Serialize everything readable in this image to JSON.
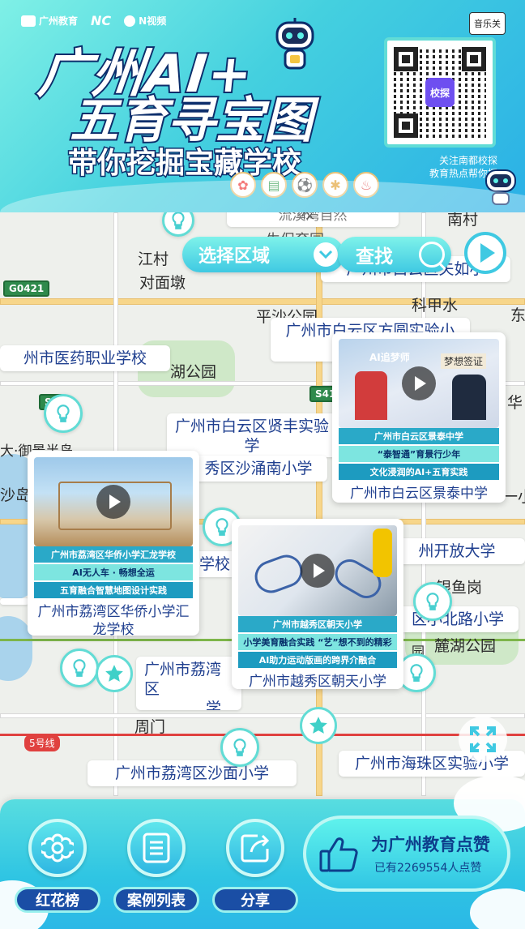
{
  "header": {
    "logos": [
      "广州教育",
      "NC",
      "N视频"
    ],
    "title_line1": "广州AI+",
    "title_line2": "五育寻宝图",
    "title_line3": "带你挖掘宝藏学校",
    "music_button": "音乐关",
    "qr_center_label": "校探",
    "follow_line1": "关注南都校探",
    "follow_line2": "教育热点帮你探",
    "edu_icons": [
      "ribbon-icon",
      "book-icon",
      "football-icon",
      "palette-icon",
      "chef-hat-icon"
    ]
  },
  "controls": {
    "area_button": "选择区域",
    "search_button": "查找"
  },
  "map": {
    "places": [
      "南村",
      "江村",
      "对面墩",
      "平沙公园",
      "科甲水",
      "麓湖公园",
      "银鱼岗",
      "周门",
      "湖公园",
      "沙岛",
      "大·御景半岛",
      "华",
      "东",
      "园",
      "一小",
      "流溪湾自然",
      "生保育园",
      "校"
    ],
    "road_shields": [
      "G0421",
      "S41",
      "S1"
    ],
    "metro_badge": "5号线",
    "labels": [
      "广州市白云区夫如小",
      "广州市白云区方圆实验小",
      "州市医药职业学校",
      "广州市白云区贤丰实验学",
      "秀区沙涌南小学",
      "学校",
      "州开放大学",
      "区小北路小学",
      "广州市荔湾区沙面小学",
      "广州市海珠区实验小学",
      "广州市荔湾区华侨小学汇龙学校",
      "广州市荔湾区",
      "学教育集团",
      "广州市越秀区朝天小学"
    ],
    "cards": [
      {
        "name": "广州市白云区景泰中学",
        "poster_title": "广州市白云区景泰中学",
        "poster_line1": "“泰智通”育景行少年",
        "poster_line2": "文化浸润的AI+五育实践",
        "poster_overlay1": "AI追梦师",
        "poster_overlay2": "梦想签证"
      },
      {
        "name": "广州市荔湾区华侨小学汇龙学校",
        "poster_title": "广州市荔湾区华侨小学汇龙学校",
        "poster_line1": "AI无人车 · 畅想全运",
        "poster_line2": "五育融合智慧地图设计实践"
      },
      {
        "name": "广州市越秀区朝天小学",
        "poster_title": "广州市越秀区朝天小学",
        "poster_line1": "小学美育融合实践 “艺”想不到的精彩",
        "poster_line2": "AI助力运动版画的跨界介融合"
      }
    ]
  },
  "bottom_bar": {
    "buttons": [
      {
        "label": "红花榜",
        "icon": "flower-icon"
      },
      {
        "label": "案例列表",
        "icon": "list-icon"
      },
      {
        "label": "分享",
        "icon": "share-icon"
      }
    ],
    "like": {
      "title": "为广州教育点赞",
      "count_text": "已有2269554人点赞"
    }
  },
  "colors": {
    "accent": "#3fc9e2",
    "label_text": "#1f3f8f",
    "dark_blue": "#1a4ea5"
  }
}
